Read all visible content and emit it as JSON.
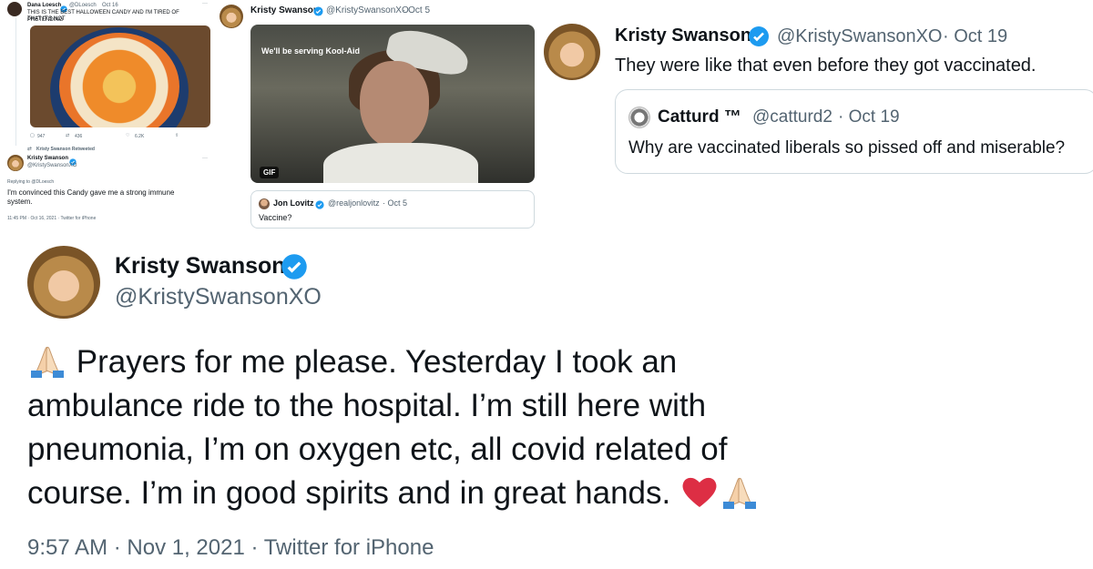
{
  "panel1": {
    "author_name": "Dana Loesch",
    "author_handle": "@DLoesch",
    "date": "Oct 16",
    "text_line1": "THIS IS THE BEST HALLOWEEN CANDY AND I'M TIRED OF PRETENDING",
    "text_line2": "THAT IT'S NOT",
    "stats": {
      "replies": "947",
      "retweets": "436",
      "likes": "6.2K"
    },
    "retweeted_by": "Kristy Swanson Retweeted",
    "reply_author_name": "Kristy Swanson",
    "reply_author_handle": "@KristySwansonXO",
    "replying_to": "Replying to @DLoesch",
    "reply_text_line1": "I'm convinced this Candy gave me a strong immune",
    "reply_text_line2": "system.",
    "reply_meta": "11:45 PM · Oct 16, 2021 · Twitter for iPhone"
  },
  "panel2": {
    "author_name": "Kristy Swanson",
    "author_handle": "@KristySwansonXO",
    "date": "· Oct 5",
    "gif_caption": "We'll be serving Kool-Aid",
    "gif_badge": "GIF",
    "quote_author_name": "Jon Lovitz",
    "quote_author_handle": "@realjonlovitz",
    "quote_date": "· Oct 5",
    "quote_text": "Vaccine?"
  },
  "panel3": {
    "author_name": "Kristy Swanson",
    "author_handle": "@KristySwansonXO",
    "date": "· Oct 19",
    "text": "They were like that even before they got vaccinated.",
    "quote_author_name": "Catturd ™",
    "quote_author_handle": "@catturd2",
    "quote_date": "· Oct 19",
    "quote_text": "Why are vaccinated liberals so pissed off and miserable?"
  },
  "panel4": {
    "author_name": "Kristy Swanson",
    "author_handle": "@KristySwansonXO",
    "text_line1": "Prayers for me please. Yesterday I took an",
    "text_line2": "ambulance ride to the hospital. I’m still here with",
    "text_line3": "pneumonia, I’m on oxygen etc, all covid related of",
    "text_line4": "course. I’m in good spirits and in great hands.",
    "meta": "9:57 AM · Nov 1, 2021 · Twitter for iPhone"
  },
  "colors": {
    "verified_blue": "#1d9bf0",
    "muted_text": "#536471",
    "heart_red": "#dd2e44"
  },
  "icons": [
    "verified-badge-icon",
    "folded-hands-emoji",
    "red-heart-emoji",
    "reply-icon",
    "retweet-icon",
    "like-icon",
    "share-icon"
  ]
}
